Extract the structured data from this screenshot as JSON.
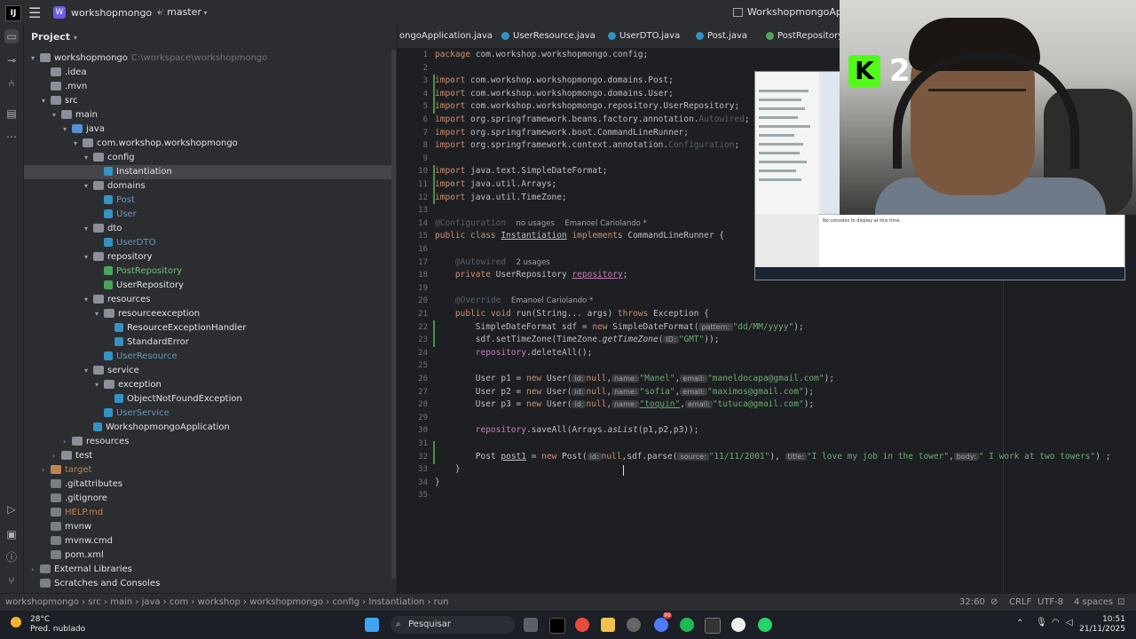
{
  "titlebar": {
    "project_badge": "W",
    "project": "workshopmongo",
    "branch": "master",
    "app_title": "WorkshopmongoApplica"
  },
  "sidebar": {
    "header": "Project",
    "tree": [
      {
        "label": "workshopmongo",
        "extra": "C:\\workspace\\workshopmongo",
        "depth": 0,
        "kind": "folder",
        "open": true
      },
      {
        "label": ".idea",
        "depth": 1,
        "kind": "folder"
      },
      {
        "label": ".mvn",
        "depth": 1,
        "kind": "folder"
      },
      {
        "label": "src",
        "depth": 1,
        "kind": "folder",
        "open": true
      },
      {
        "label": "main",
        "depth": 2,
        "kind": "folder",
        "open": true
      },
      {
        "label": "java",
        "depth": 3,
        "kind": "folder-blue",
        "open": true
      },
      {
        "label": "com.workshop.workshopmongo",
        "depth": 4,
        "kind": "folder",
        "open": true
      },
      {
        "label": "config",
        "depth": 5,
        "kind": "folder",
        "open": true
      },
      {
        "label": "Instantiation",
        "depth": 6,
        "kind": "class",
        "selected": true
      },
      {
        "label": "domains",
        "depth": 5,
        "kind": "folder",
        "open": true
      },
      {
        "label": "Post",
        "depth": 6,
        "kind": "class",
        "color": "blue"
      },
      {
        "label": "User",
        "depth": 6,
        "kind": "class",
        "color": "blue"
      },
      {
        "label": "dto",
        "depth": 5,
        "kind": "folder",
        "open": true
      },
      {
        "label": "UserDTO",
        "depth": 6,
        "kind": "class",
        "color": "blue"
      },
      {
        "label": "repository",
        "depth": 5,
        "kind": "folder",
        "open": true
      },
      {
        "label": "PostRepository",
        "depth": 6,
        "kind": "class-green",
        "color": "green"
      },
      {
        "label": "UserRepository",
        "depth": 6,
        "kind": "class-green"
      },
      {
        "label": "resources",
        "depth": 5,
        "kind": "folder",
        "open": true
      },
      {
        "label": "resourceexception",
        "depth": 6,
        "kind": "folder",
        "open": true
      },
      {
        "label": "ResourceExceptionHandler",
        "depth": 7,
        "kind": "class"
      },
      {
        "label": "StandardError",
        "depth": 7,
        "kind": "class"
      },
      {
        "label": "UserResource",
        "depth": 6,
        "kind": "class",
        "color": "blue"
      },
      {
        "label": "service",
        "depth": 5,
        "kind": "folder",
        "open": true
      },
      {
        "label": "exception",
        "depth": 6,
        "kind": "folder",
        "open": true
      },
      {
        "label": "ObjectNotFoundException",
        "depth": 7,
        "kind": "class"
      },
      {
        "label": "UserService",
        "depth": 6,
        "kind": "class",
        "color": "blue"
      },
      {
        "label": "WorkshopmongoApplication",
        "depth": 5,
        "kind": "class"
      },
      {
        "label": "resources",
        "depth": 3,
        "kind": "folder",
        "closed": true
      },
      {
        "label": "test",
        "depth": 2,
        "kind": "folder",
        "closed": true
      },
      {
        "label": "target",
        "depth": 1,
        "kind": "folder-orange",
        "closed": true,
        "color": "orange"
      },
      {
        "label": ".gitattributes",
        "depth": 1,
        "kind": "file"
      },
      {
        "label": ".gitignore",
        "depth": 1,
        "kind": "file"
      },
      {
        "label": "HELP.md",
        "depth": 1,
        "kind": "file-md",
        "color": "orange"
      },
      {
        "label": "mvnw",
        "depth": 1,
        "kind": "file"
      },
      {
        "label": "mvnw.cmd",
        "depth": 1,
        "kind": "file"
      },
      {
        "label": "pom.xml",
        "depth": 1,
        "kind": "file"
      },
      {
        "label": "External Libraries",
        "depth": 0,
        "kind": "folder-ex",
        "closed": true
      },
      {
        "label": "Scratches and Consoles",
        "depth": 0,
        "kind": "folder-ex"
      }
    ]
  },
  "tabs": [
    {
      "label": "ongoApplication.java",
      "icon": "class-icon"
    },
    {
      "label": "UserResource.java",
      "icon": "class-icon"
    },
    {
      "label": "UserDTO.java",
      "icon": "class-icon"
    },
    {
      "label": "Post.java",
      "icon": "class-icon"
    },
    {
      "label": "PostRepository.j",
      "icon": "interface-icon"
    }
  ],
  "editor": {
    "line_numbers": [
      "1",
      "2",
      "3",
      "4",
      "5",
      "6",
      "7",
      "8",
      "9",
      "10",
      "11",
      "12",
      "13",
      "14",
      "15",
      "16",
      "17",
      "18",
      "19",
      "20",
      "21",
      "22",
      "23",
      "24",
      "25",
      "26",
      "27",
      "28",
      "29",
      "30",
      "31",
      "32",
      "33",
      "34",
      "35"
    ],
    "l1a": "package ",
    "l1b": "com.workshop.workshopmongo.config;",
    "l3a": "import ",
    "l3b": "com.workshop.workshopmongo.domains.Post;",
    "l4a": "import ",
    "l4b": "com.workshop.workshopmongo.domains.User;",
    "l5a": "import ",
    "l5b": "com.workshop.workshopmongo.repository.UserRepository;",
    "l6a": "import ",
    "l6b": "org.springframework.beans.factory.annotation.",
    "l6c": "Autowired",
    "l6d": ";",
    "l7a": "import ",
    "l7b": "org.springframework.boot.CommandLineRunner;",
    "l8a": "import ",
    "l8b": "org.springframework.context.annotation.",
    "l8c": "Configuration",
    "l8d": ";",
    "l10a": "import ",
    "l10b": "java.text.SimpleDateFormat;",
    "l11a": "import ",
    "l11b": "java.util.Arrays;",
    "l12a": "import ",
    "l12b": "java.util.TimeZone;",
    "l14a": "@Configuration",
    "l14usage": "no usages",
    "l14author": "Emanoel Cariolando *",
    "l15a": "public class ",
    "l15b": "Instantiation",
    "l15c": " implements ",
    "l15d": "CommandLineRunner {",
    "l17a": "@Autowired",
    "l17usage": "2 usages",
    "l18a": "private ",
    "l18b": "UserRepository ",
    "l18c": "repository",
    "l18d": ";",
    "l20a": "@Override",
    "l20author": "Emanoel Cariolando *",
    "l21a": "public void ",
    "l21b": "run(String... args) ",
    "l21c": "throws ",
    "l21d": "Exception {",
    "l22a": "SimpleDateFormat sdf = ",
    "l22b": "new ",
    "l22c": "SimpleDateFormat(",
    "l22h": "pattern:",
    "l22s": "\"dd/MM/yyyy\"",
    "l22e": ");",
    "l23a": "sdf.setTimeZone(TimeZone.",
    "l23b": "getTimeZone",
    "l23c": "(",
    "l23h": "ID:",
    "l23s": "\"GMT\"",
    "l23e": "));",
    "l24a": "repository",
    "l24b": ".deleteAll();",
    "l26a": "User p1 = ",
    "l26b": "new ",
    "l26c": "User(",
    "l26h1": "id:",
    "l26n": "null",
    "l26h2": "name:",
    "l26s1": "\"Manel\"",
    "l26h3": "email:",
    "l26s2": "\"maneldocapa@gmail.com\"",
    "l26e": ");",
    "l27a": "User p2 = ",
    "l27b": "new ",
    "l27c": "User(",
    "l27h1": "id:",
    "l27n": "null",
    "l27h2": "name:",
    "l27s1": "\"sofia\"",
    "l27h3": "email:",
    "l27s2": "\"maximos@gmail.com\"",
    "l27e": ");",
    "l28a": "User p3 = ",
    "l28b": "new ",
    "l28c": "User(",
    "l28h1": "id:",
    "l28n": "null",
    "l28h2": "name:",
    "l28s1": "\"toquin\"",
    "l28h3": "email:",
    "l28s2": "\"tutuca@gmail.com\"",
    "l28e": ");",
    "l30a": "repository",
    "l30b": ".saveAll(Arrays.",
    "l30c": "asList",
    "l30d": "(p1,p2,p3));",
    "l32a": "Post ",
    "l32b": "post1",
    "l32c": " = ",
    "l32d": "new ",
    "l32e": "Post(",
    "l32h1": "id:",
    "l32n": "null",
    "l32f": ",sdf.parse(",
    "l32h2": "source:",
    "l32s1": "\"11/11/2001\"",
    "l32g": "), ",
    "l32h3": "title:",
    "l32s2": "\"I love my job in the tower\"",
    "l32i": ",",
    "l32h4": "body:",
    "l32s3": "\" I work at two towers\"",
    "l32j": ") ;",
    "l33": "}",
    "l34": "}"
  },
  "overlay": {
    "kick_letter": "K",
    "kick_number": "2",
    "console_text": "No consoles to display at this time."
  },
  "statusbar": {
    "crumbs": [
      "workshopmongo",
      "src",
      "main",
      "java",
      "com",
      "workshop",
      "workshopmongo",
      "config",
      "Instantiation",
      "run"
    ],
    "position": "32:60",
    "line_ending": "CRLF",
    "encoding": "UTF-8",
    "indent": "4 spaces"
  },
  "taskbar": {
    "temp": "28°C",
    "weather": "Pred. nublado",
    "search": "Pesquisar",
    "time": "10:51",
    "date": "21/11/2025",
    "badge_teams": "99"
  }
}
